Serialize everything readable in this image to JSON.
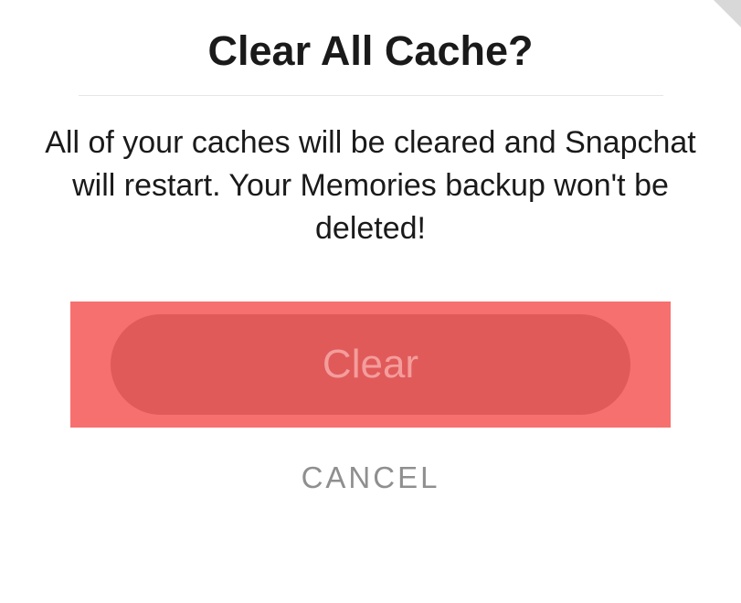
{
  "dialog": {
    "title": "Clear All Cache?",
    "message": "All of your caches will be cleared and Snapchat will restart. Your Memories backup won't be deleted!",
    "clear_label": "Clear",
    "cancel_label": "CANCEL"
  }
}
